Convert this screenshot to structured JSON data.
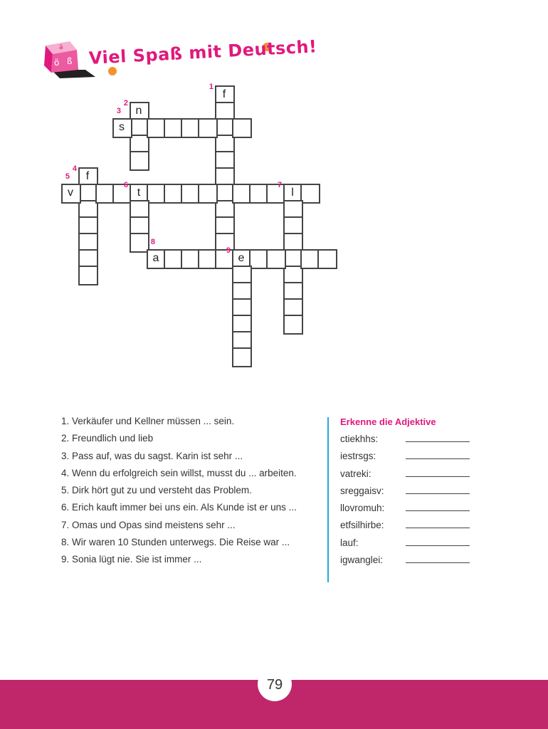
{
  "header": {
    "title": "Viel Spaß mit Deutsch!",
    "logo_letters": [
      "ä",
      "ö",
      "ß"
    ]
  },
  "colors": {
    "accent_pink": "#e0197d",
    "accent_orange": "#f39230",
    "accent_blue": "#29a8e0",
    "footer": "#c0266a"
  },
  "crossword": {
    "words": [
      {
        "number": "1",
        "direction": "down",
        "first_letter": "f",
        "length": 10
      },
      {
        "number": "2",
        "direction": "down",
        "first_letter": "n",
        "length": 4
      },
      {
        "number": "3",
        "direction": "across",
        "first_letter": "s",
        "length": 8
      },
      {
        "number": "4",
        "direction": "down",
        "first_letter": "f",
        "length": 7
      },
      {
        "number": "5",
        "direction": "across",
        "first_letter": "v",
        "length": 15
      },
      {
        "number": "6",
        "direction": "down",
        "first_letter": "t",
        "length": 4
      },
      {
        "number": "7",
        "direction": "down",
        "first_letter": "l",
        "length": 9
      },
      {
        "number": "8",
        "direction": "across",
        "first_letter": "a",
        "length": 11
      },
      {
        "number": "9",
        "direction": "down",
        "first_letter": "e",
        "length": 7
      }
    ]
  },
  "clues": [
    "1. Verkäufer und Kellner müssen ... sein.",
    "2. Freundlich und lieb",
    "3. Pass auf, was du sagst. Karin ist sehr ...",
    "4. Wenn du erfolgreich sein willst, musst du ... arbeiten.",
    "5. Dirk hört gut zu und versteht das Problem.",
    "6. Erich kauft immer bei uns ein. Als Kunde ist er uns ...",
    "7. Omas und Opas sind meistens sehr ...",
    "8. Wir waren 10 Stunden unterwegs. Die Reise war ...",
    "9. Sonia lügt nie. Sie ist immer ..."
  ],
  "adjectives": {
    "heading": "Erkenne die Adjektive",
    "items": [
      "ctiekhhs:",
      "iestrsgs:",
      "vatreki:",
      "sreggaisv:",
      "llovromuh:",
      "etfsilhirbe:",
      "lauf:",
      "igwanglei:"
    ]
  },
  "page_number": "79"
}
